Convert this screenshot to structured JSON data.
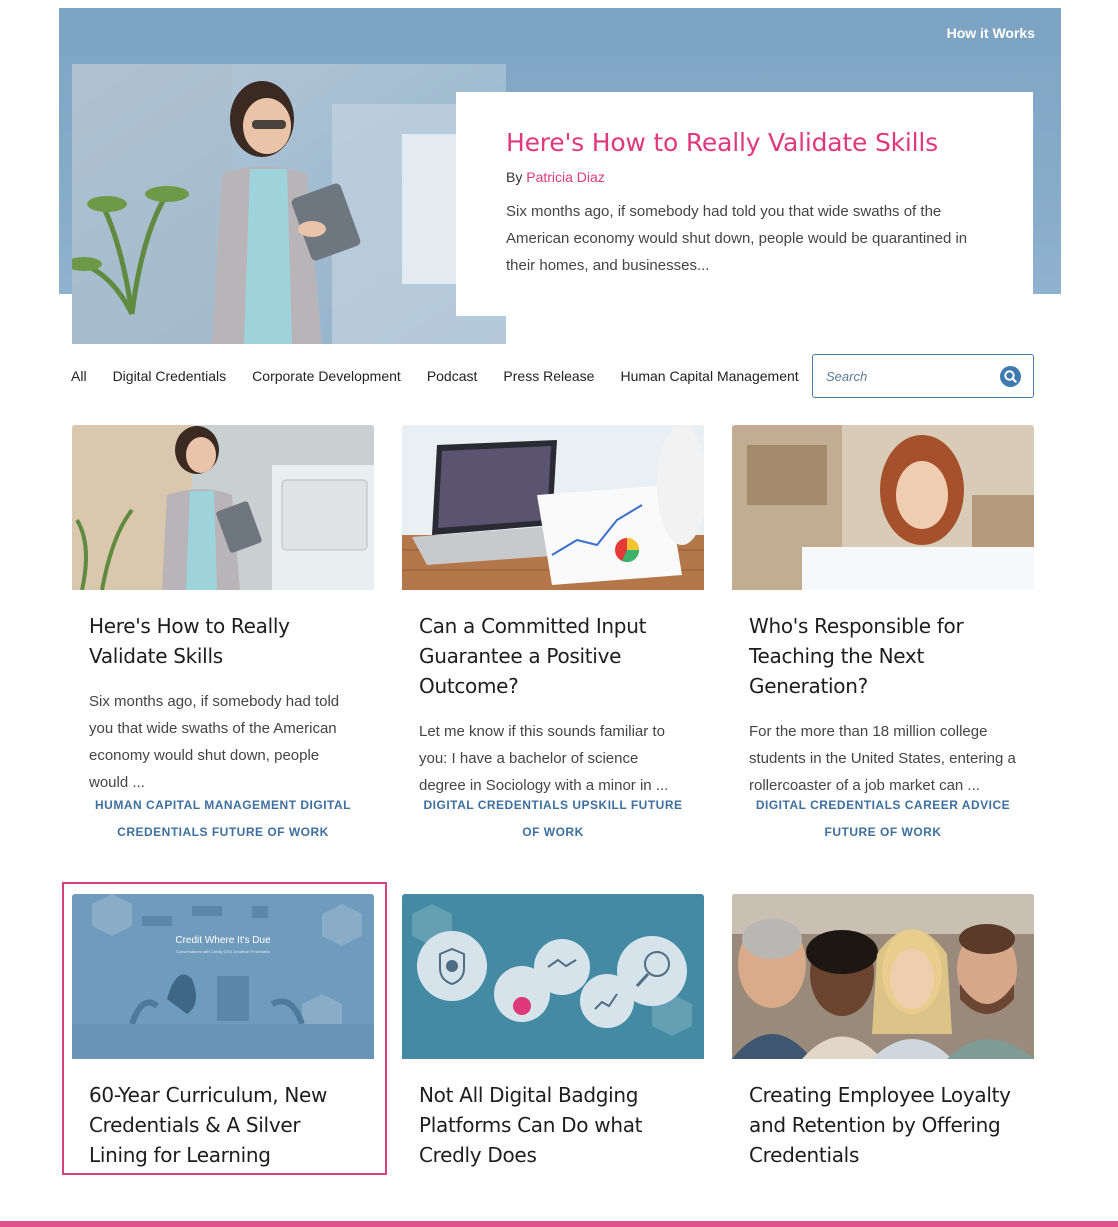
{
  "nav": {
    "how_it_works": "How it Works"
  },
  "hero": {
    "title": "Here's How to Really Validate Skills",
    "by_label": "By",
    "author": "Patricia Diaz",
    "excerpt": "Six months ago, if somebody had told you that wide swaths of the American economy would shut down, people would be quarantined in their homes, and businesses..."
  },
  "filters": [
    "All",
    "Digital Credentials",
    "Corporate Development",
    "Podcast",
    "Press Release",
    "Human Capital Management"
  ],
  "search": {
    "placeholder": "Search"
  },
  "posts": [
    {
      "title": "Here's How to Really Validate Skills",
      "excerpt": "Six months ago, if somebody had told you that wide swaths of the American economy would shut down, people would ...",
      "tags": "HUMAN CAPITAL MANAGEMENT DIGITAL CREDENTIALS FUTURE OF WORK"
    },
    {
      "title": "Can a Committed Input Guarantee a Positive Outcome?",
      "excerpt": "Let me know if this sounds familiar to you:  I have a bachelor of science degree in Sociology with a minor in ...",
      "tags": "DIGITAL CREDENTIALS UPSKILL FUTURE OF WORK"
    },
    {
      "title": "Who's Responsible for Teaching the Next Generation?",
      "excerpt": "For the more than 18 million college students in the United States, entering a rollercoaster of a job market can ...",
      "tags": "DIGITAL CREDENTIALS CAREER ADVICE FUTURE OF WORK"
    },
    {
      "title": "60-Year Curriculum,  New Credentials & A Silver Lining for Learning",
      "image_text": "Credit Where It's Due",
      "image_subtext": "Conversations with Credly CEO Jonathan Finkelstein"
    },
    {
      "title": "Not All Digital Badging Platforms Can Do what Credly Does"
    },
    {
      "title": "Creating Employee Loyalty and Retention by Offering Credentials"
    }
  ],
  "colors": {
    "accent_pink": "#e0387c",
    "tag_blue": "#3e6f9e",
    "hero_blue": "#86abc9"
  }
}
